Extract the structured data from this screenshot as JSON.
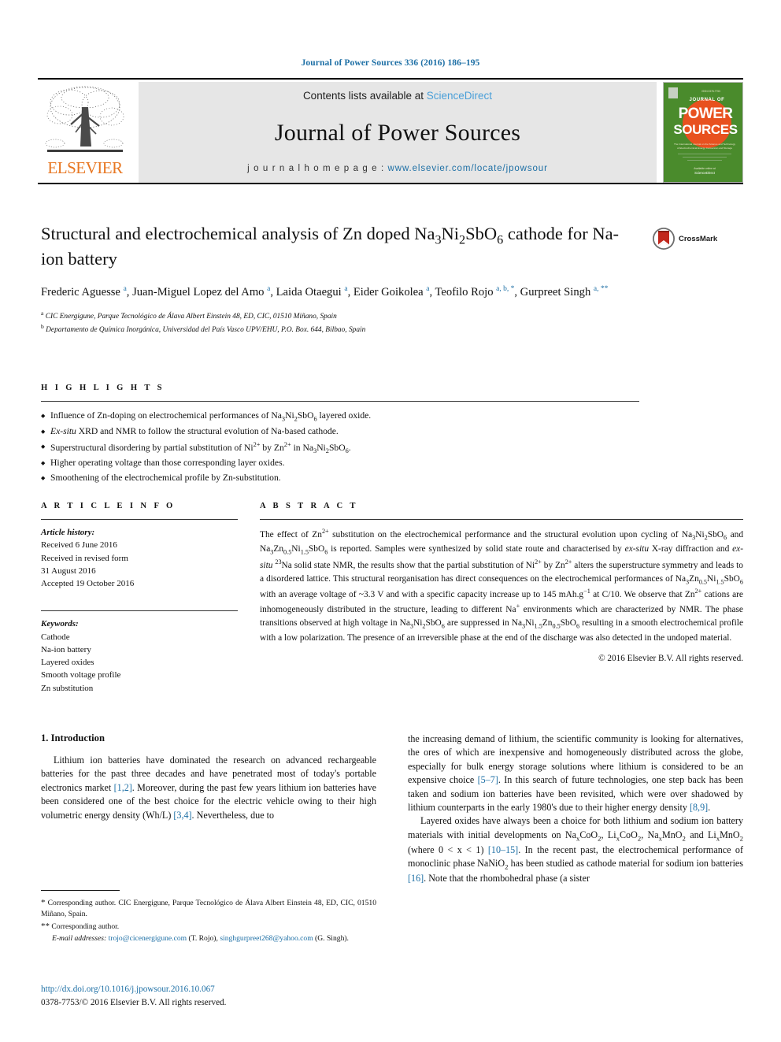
{
  "running_head": "Journal of Power Sources 336 (2016) 186–195",
  "masthead": {
    "contents_prefix": "Contents lists available at ",
    "sciencedirect": "ScienceDirect",
    "journal_name": "Journal of Power Sources",
    "homepage_prefix": "j o u r n a l   h o m e p a g e :  ",
    "homepage_url": "www.elsevier.com/locate/jpowsour",
    "publisher": "ELSEVIER",
    "cover_line1": "JOURNAL OF",
    "cover_line2": "POWER",
    "cover_line3": "SOURCES"
  },
  "article": {
    "title_html": "Structural and electrochemical analysis of Zn doped Na<sub>3</sub>Ni<sub>2</sub>SbO<sub>6</sub> cathode for Na-ion battery",
    "authors_html": "Frederic Aguesse <span class=\"affil-mark\">a</span>, Juan-Miguel Lopez del Amo <span class=\"affil-mark\">a</span>, Laida Otaegui <span class=\"affil-mark\">a</span>, Eider Goikolea <span class=\"affil-mark\">a</span>, Teofilo Rojo <span class=\"affil-mark\">a, b, *</span>, Gurpreet Singh <span class=\"affil-mark\">a, **</span>",
    "affiliation_a": "CIC Energigune, Parque Tecnológico de Álava Albert Einstein 48, ED, CIC, 01510 Miñano, Spain",
    "affiliation_b": "Departamento de Química Inorgánica, Universidad del País Vasco UPV/EHU, P.O. Box. 644, Bilbao, Spain",
    "crossmark_label": "CrossMark"
  },
  "highlights": {
    "heading": "H I G H L I G H T S",
    "items_html": [
      "Influence of Zn-doping on electrochemical performances of Na<sub>3</sub>Ni<sub>2</sub>SbO<sub>6</sub> layered oxide.",
      "<i>Ex-situ</i> XRD and NMR to follow the structural evolution of Na-based cathode.",
      "Superstructural disordering by partial substitution of Ni<sup>2+</sup> by Zn<sup>2+</sup> in Na<sub>3</sub>Ni<sub>2</sub>SbO<sub>6</sub>.",
      "Higher operating voltage than those corresponding layer oxides.",
      "Smoothening of the electrochemical profile by Zn-substitution."
    ]
  },
  "article_info": {
    "heading": "A R T I C L E   I N F O",
    "history_label": "Article history:",
    "history_lines": [
      "Received 6 June 2016",
      "Received in revised form",
      "31 August 2016",
      "Accepted 19 October 2016"
    ],
    "keywords_label": "Keywords:",
    "keywords": [
      "Cathode",
      "Na-ion battery",
      "Layered oxides",
      "Smooth voltage profile",
      "Zn substitution"
    ]
  },
  "abstract": {
    "heading": "A B S T R A C T",
    "text_html": "The effect of Zn<sup>2+</sup> substitution on the electrochemical performance and the structural evolution upon cycling of Na<sub>3</sub>Ni<sub>2</sub>SbO<sub>6</sub> and Na<sub>3</sub>Zn<sub>0.5</sub>Ni<sub>1.5</sub>SbO<sub>6</sub> is reported. Samples were synthesized by solid state route and characterised by <i>ex-situ</i> X-ray diffraction and <i>ex-situ</i> <sup>23</sup>Na solid state NMR, the results show that the partial substitution of Ni<sup>2+</sup> by Zn<sup>2+</sup> alters the superstructure symmetry and leads to a disordered lattice. This structural reorganisation has direct consequences on the electrochemical performances of Na<sub>3</sub>Zn<sub>0.5</sub>Ni<sub>1.5</sub>SbO<sub>6</sub> with an average voltage of ~3.3 V and with a specific capacity increase up to 145 mAh.g<sup>−1</sup> at C/10. We observe that Zn<sup>2+</sup> cations are inhomogeneously distributed in the structure, leading to different Na<sup>+</sup> environments which are characterized by NMR. The phase transitions observed at high voltage in Na<sub>3</sub>Ni<sub>2</sub>SbO<sub>6</sub> are suppressed in Na<sub>3</sub>Ni<sub>1.5</sub>Zn<sub>0.5</sub>SbO<sub>6</sub> resulting in a smooth electrochemical profile with a low polarization. The presence of an irreversible phase at the end of the discharge was also detected in the undoped material.",
    "copyright": "© 2016 Elsevier B.V. All rights reserved."
  },
  "body": {
    "section_heading": "1.  Introduction",
    "left_paragraph_html": "Lithium ion batteries have dominated the research on advanced rechargeable batteries for the past three decades and have penetrated most of today's portable electronics market <span class=\"ref\">[1,2]</span>. Moreover, during the past few years lithium ion batteries have been considered one of the best choice for the electric vehicle owing to their high volumetric energy density (Wh/L) <span class=\"ref\">[3,4]</span>. Nevertheless, due to",
    "right_paragraph1_html": "the increasing demand of lithium, the scientific community is looking for alternatives, the ores of which are inexpensive and homogeneously distributed across the globe, especially for bulk energy storage solutions where lithium is considered to be an expensive choice <span class=\"ref\">[5–7]</span>. In this search of future technologies, one step back has been taken and sodium ion batteries have been revisited, which were over shadowed by lithium counterparts in the early 1980's due to their higher energy density <span class=\"ref\">[8,9]</span>.",
    "right_paragraph2_html": "Layered oxides have always been a choice for both lithium and sodium ion battery materials with initial developments on Na<sub>x</sub>CoO<sub>2</sub>, Li<sub>x</sub>CoO<sub>2</sub>, Na<sub>x</sub>MnO<sub>2</sub> and Li<sub>x</sub>MnO<sub>2</sub> (where 0 &lt; x &lt; 1) <span class=\"ref\">[10–15]</span>. In the recent past, the electrochemical performance of monoclinic phase NaNiO<sub>2</sub> has been studied as cathode material for sodium ion batteries <span class=\"ref\">[16]</span>. Note that the rhombohedral phase (a sister"
  },
  "footnotes": {
    "fn1_html": "<span class=\"star\">*</span> Corresponding author. CIC Energigune, Parque Tecnológico de Álava Albert Einstein 48, ED, CIC, 01510 Miñano, Spain.",
    "fn2_html": "<span class=\"star\">**</span> Corresponding author.",
    "fn3_html": "<span class=\"it\">E-mail addresses:</span> <span class=\"link\">trojo@cicenergigune.com</span> (T. Rojo), <span class=\"link\">singhgurpreet268@yahoo.com</span> (G. Singh).",
    "doi": "http://dx.doi.org/10.1016/j.jpowsour.2016.10.067",
    "issn_line": "0378-7753/© 2016 Elsevier B.V. All rights reserved."
  },
  "colors": {
    "link_blue": "#1d6fa5",
    "sciencedirect_blue": "#4a9fd8",
    "elsevier_orange": "#e87722",
    "cover_green": "#4a8b2c",
    "masthead_grey": "#e6e6e6"
  }
}
